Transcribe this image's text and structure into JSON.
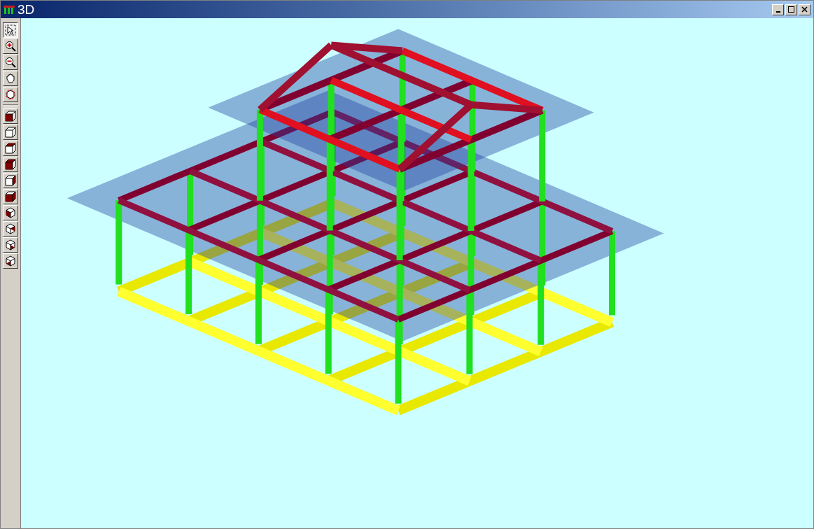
{
  "window": {
    "title": "3D"
  },
  "toolbar": [
    {
      "kind": "select",
      "selected": true
    },
    {
      "kind": "zoomin",
      "selected": false
    },
    {
      "kind": "zoomout",
      "selected": false
    },
    {
      "kind": "pan",
      "selected": false
    },
    {
      "kind": "orbit",
      "selected": false
    },
    {
      "kind": "view",
      "selected": false
    },
    {
      "kind": "view",
      "selected": false
    },
    {
      "kind": "view",
      "selected": false
    },
    {
      "kind": "view",
      "selected": false
    },
    {
      "kind": "view",
      "selected": false
    },
    {
      "kind": "view",
      "selected": false
    },
    {
      "kind": "view",
      "selected": false
    },
    {
      "kind": "view",
      "selected": false
    },
    {
      "kind": "view",
      "selected": false
    },
    {
      "kind": "view",
      "selected": false
    }
  ]
}
